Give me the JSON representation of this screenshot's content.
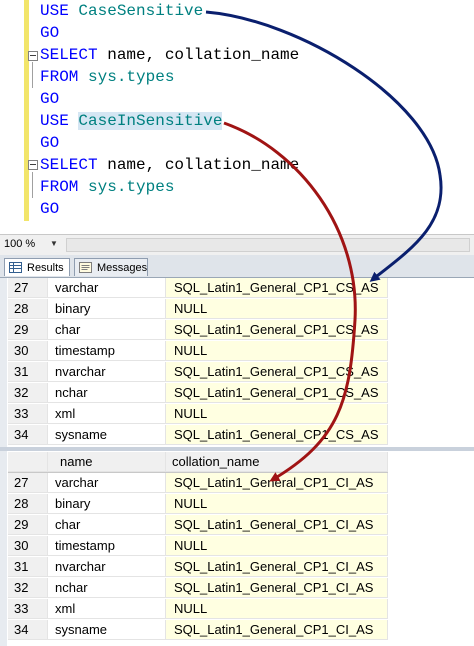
{
  "editor": {
    "lines": [
      {
        "kw": "USE",
        "rest": "CaseSensitive"
      },
      {
        "kw": "GO"
      },
      {
        "kw": "SELECT",
        "rest": "name, collation_name"
      },
      {
        "kw": "FROM",
        "rest": "sys.types"
      },
      {
        "kw": "GO"
      },
      {
        "kw": "USE",
        "rest": "CaseInSensitive"
      },
      {
        "kw": "GO"
      },
      {
        "kw": "SELECT",
        "rest": "name, collation_name"
      },
      {
        "kw": "FROM",
        "rest": "sys.types"
      },
      {
        "kw": "GO"
      }
    ]
  },
  "zoom": "100 %",
  "tabs": [
    {
      "label": "Results",
      "icon": "results-grid-icon",
      "active": true
    },
    {
      "label": "Messages",
      "icon": "messages-icon",
      "active": false
    }
  ],
  "grid1": {
    "rows": [
      {
        "num": "27",
        "name": "varchar",
        "collation": "SQL_Latin1_General_CP1_CS_AS"
      },
      {
        "num": "28",
        "name": "binary",
        "collation": "NULL"
      },
      {
        "num": "29",
        "name": "char",
        "collation": "SQL_Latin1_General_CP1_CS_AS"
      },
      {
        "num": "30",
        "name": "timestamp",
        "collation": "NULL"
      },
      {
        "num": "31",
        "name": "nvarchar",
        "collation": "SQL_Latin1_General_CP1_CS_AS"
      },
      {
        "num": "32",
        "name": "nchar",
        "collation": "SQL_Latin1_General_CP1_CS_AS"
      },
      {
        "num": "33",
        "name": "xml",
        "collation": "NULL"
      },
      {
        "num": "34",
        "name": "sysname",
        "collation": "SQL_Latin1_General_CP1_CS_AS"
      }
    ]
  },
  "grid2": {
    "headers": {
      "name": "name",
      "collation": "collation_name"
    },
    "rows": [
      {
        "num": "27",
        "name": "varchar",
        "collation": "SQL_Latin1_General_CP1_CI_AS"
      },
      {
        "num": "28",
        "name": "binary",
        "collation": "NULL"
      },
      {
        "num": "29",
        "name": "char",
        "collation": "SQL_Latin1_General_CP1_CI_AS"
      },
      {
        "num": "30",
        "name": "timestamp",
        "collation": "NULL"
      },
      {
        "num": "31",
        "name": "nvarchar",
        "collation": "SQL_Latin1_General_CP1_CI_AS"
      },
      {
        "num": "32",
        "name": "nchar",
        "collation": "SQL_Latin1_General_CP1_CI_AS"
      },
      {
        "num": "33",
        "name": "xml",
        "collation": "NULL"
      },
      {
        "num": "34",
        "name": "sysname",
        "collation": "SQL_Latin1_General_CP1_CI_AS"
      }
    ]
  },
  "colors": {
    "keyword": "#0000ff",
    "database": "#008080",
    "arrow_blue": "#0a1f6e",
    "arrow_red": "#a01414",
    "collation_cell_bg": "#ffffe1"
  }
}
